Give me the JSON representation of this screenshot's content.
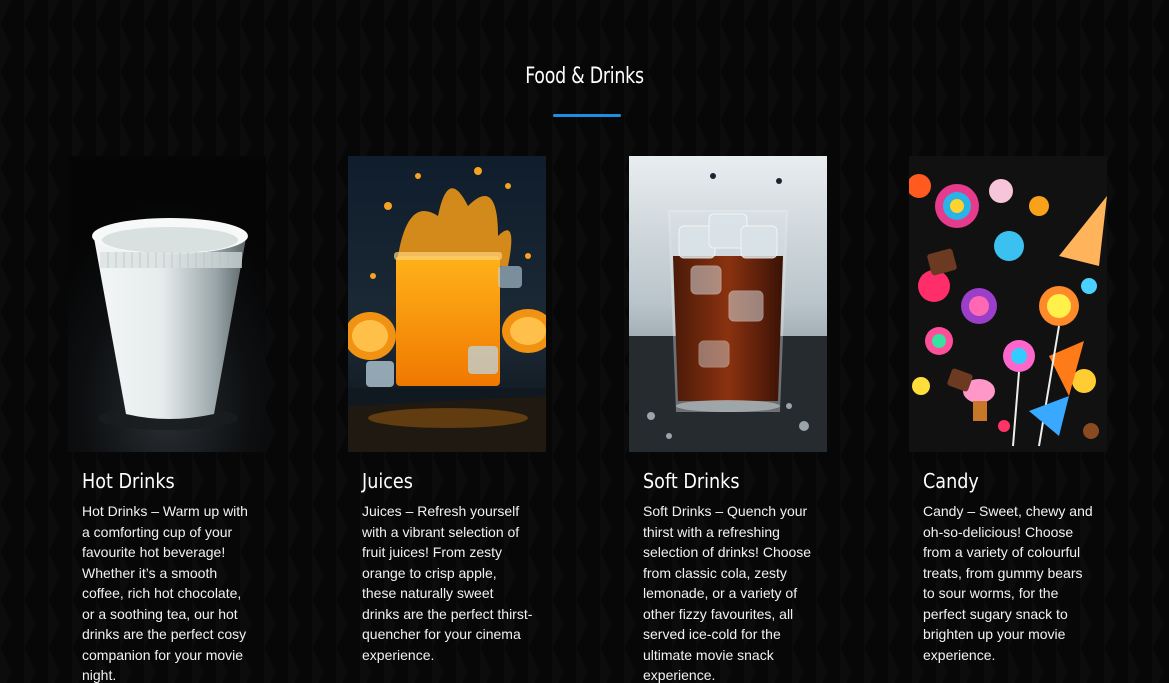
{
  "section": {
    "title": "Food & Drinks"
  },
  "cards": [
    {
      "title": "Hot Drinks",
      "description": "Hot Drinks – Warm up with a comforting cup of your favourite hot beverage! Whether it’s a smooth coffee, rich hot chocolate, or a soothing tea, our hot drinks are the perfect cosy companion for your movie night."
    },
    {
      "title": "Juices",
      "description": "Juices – Refresh yourself with a vibrant selection of fruit juices! From zesty orange to crisp apple, these naturally sweet drinks are the perfect thirst-quencher for your cinema experience."
    },
    {
      "title": "Soft Drinks",
      "description": "Soft Drinks – Quench your thirst with a refreshing selection of drinks! Choose from classic cola, zesty lemonade, or a variety of other fizzy favourites, all served ice-cold for the ultimate movie snack experience."
    },
    {
      "title": "Candy",
      "description": "Candy – Sweet, chewy and oh-so-delicious! Choose from a variety of colourful treats, from gummy bears to sour worms, for the perfect sugary snack to brighten up your movie experience."
    }
  ],
  "colors": {
    "accent": "#1e8fe0",
    "background": "#070707",
    "text": "#ffffff"
  }
}
